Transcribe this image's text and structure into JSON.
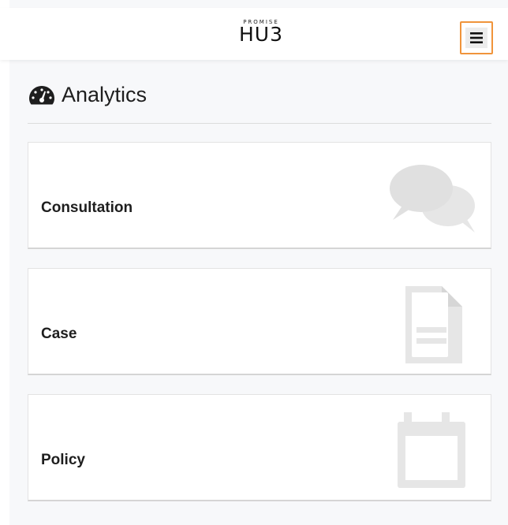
{
  "header": {
    "brand_small": "PROMISE",
    "brand_big": "HU3",
    "menu_icon": "hamburger-icon"
  },
  "page": {
    "title": "Analytics",
    "title_icon": "tachometer-icon"
  },
  "cards": [
    {
      "label": "Consultation",
      "icon": "comments-icon"
    },
    {
      "label": "Case",
      "icon": "document-icon"
    },
    {
      "label": "Policy",
      "icon": "calendar-icon"
    }
  ],
  "colors": {
    "menu_border": "#f0943b",
    "card_icon": "#e6e6e6",
    "background": "#f7f8fa"
  }
}
